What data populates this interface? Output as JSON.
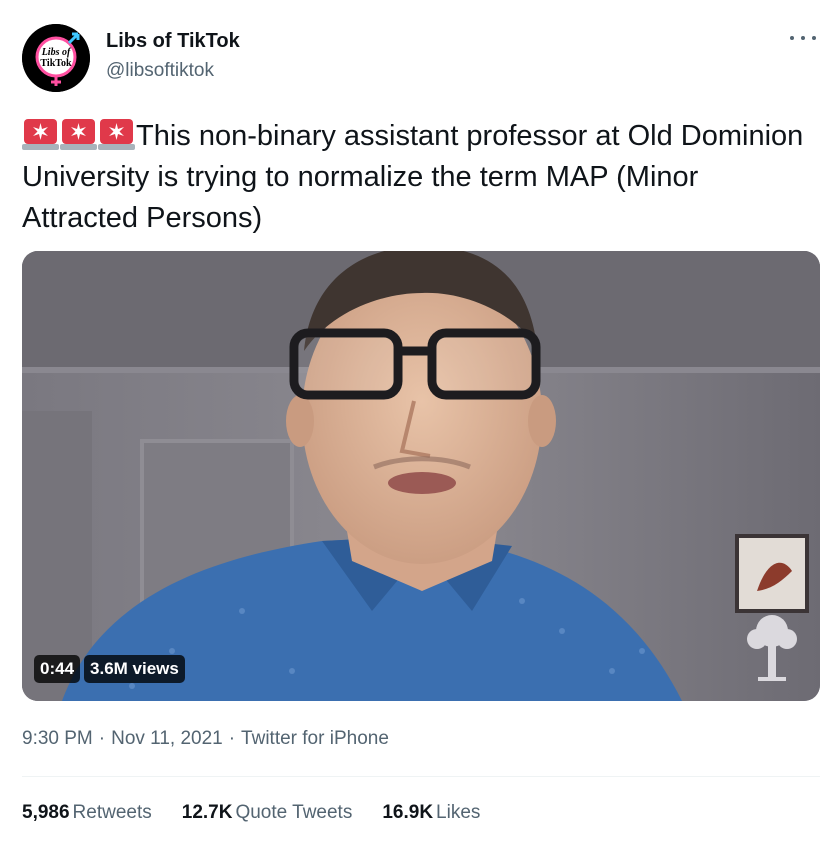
{
  "author": {
    "display_name": "Libs of TikTok",
    "handle": "@libsoftiktok",
    "avatar_text_line1": "Libs of",
    "avatar_text_line2": "TikTok",
    "avatar_icon": "gender-symbol-logo"
  },
  "more_icon": "ellipsis-icon",
  "tweet": {
    "emoji_icon": "police-light-icon",
    "emoji_count": 3,
    "text": "This non-binary assistant professor at Old Dominion University is trying to normalize the term MAP (Minor Attracted Persons)"
  },
  "video": {
    "duration": "0:44",
    "views": "3.6M views"
  },
  "meta": {
    "time": "9:30 PM",
    "date": "Nov 11, 2021",
    "source": "Twitter for iPhone",
    "separator": "·"
  },
  "stats": {
    "retweets_count": "5,986",
    "retweets_label": "Retweets",
    "quotes_count": "12.7K",
    "quotes_label": "Quote Tweets",
    "likes_count": "16.9K",
    "likes_label": "Likes"
  },
  "colors": {
    "text_primary": "#0f1419",
    "text_secondary": "#536471",
    "siren_red": "#e0394a"
  }
}
